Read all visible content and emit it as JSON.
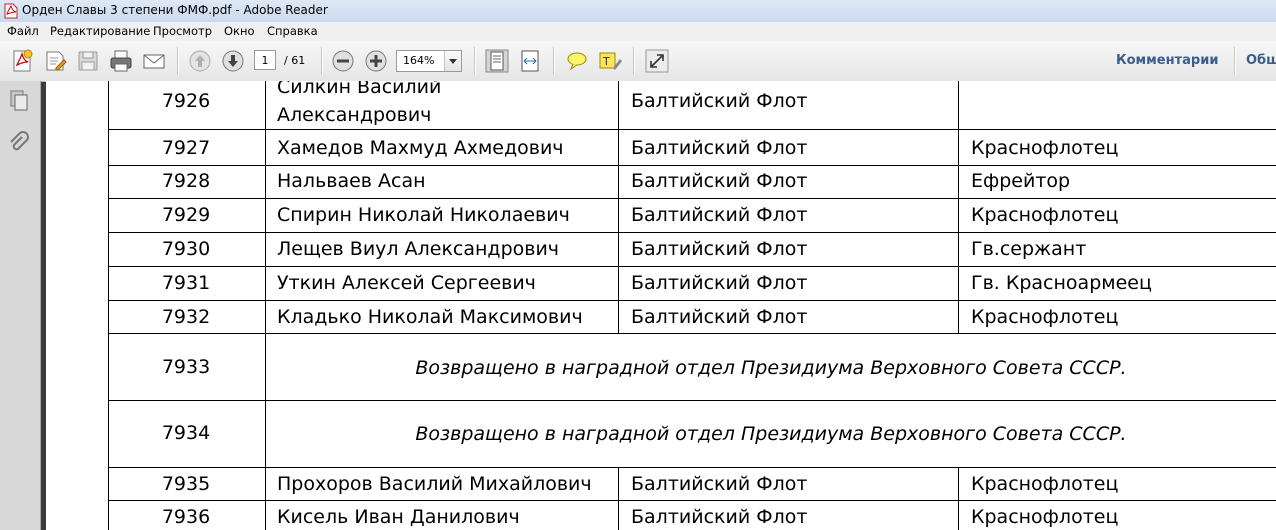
{
  "window": {
    "title": "Орден Славы 3 степени ФМФ.pdf - Adobe Reader"
  },
  "menu": [
    "Файл",
    "Редактирование",
    "Просмотр",
    "Окно",
    "Справка"
  ],
  "toolbar": {
    "current_page": "1",
    "total_pages": "/ 61",
    "zoom": "164%",
    "comments_label": "Комментарии",
    "share_label": "Общ"
  },
  "icons": {
    "create": "create-pdf-icon",
    "edit": "edit-icon",
    "save": "save-icon",
    "print": "print-icon",
    "email": "email-icon",
    "prev": "arrow-up-icon",
    "next": "arrow-down-icon",
    "zoom_out": "zoom-out-icon",
    "zoom_in": "zoom-in-icon",
    "fit_page": "fit-page-icon",
    "fit_width": "fit-width-icon",
    "comment": "comment-icon",
    "highlight": "highlight-icon",
    "fullscreen": "expand-icon"
  },
  "document": {
    "rows": [
      {
        "num": "7926",
        "name_line1": "Силкин Василий",
        "name_line2": "Александрович",
        "fleet": "Балтийский Флот",
        "rank": ""
      },
      {
        "num": "7927",
        "name": "Хамедов Махмуд Ахмедович",
        "fleet": "Балтийский Флот",
        "rank": "Краснофлотец"
      },
      {
        "num": "7928",
        "name": "Нальваев Асан",
        "fleet": "Балтийский Флот",
        "rank": "Ефрейтор"
      },
      {
        "num": "7929",
        "name": "Спирин Николай Николаевич",
        "fleet": "Балтийский Флот",
        "rank": "Краснофлотец"
      },
      {
        "num": "7930",
        "name": "Лещев Виул Александрович",
        "fleet": "Балтийский Флот",
        "rank": "Гв.сержант"
      },
      {
        "num": "7931",
        "name": "Уткин Алексей Сергеевич",
        "fleet": "Балтийский Флот",
        "rank": "Гв. Красноармеец"
      },
      {
        "num": "7932",
        "name": "Кладько Николай Максимович",
        "fleet": "Балтийский Флот",
        "rank": "Краснофлотец"
      },
      {
        "num": "7933",
        "note": "Возвращено в наградной отдел Президиума Верховного Совета СССР."
      },
      {
        "num": "7934",
        "note": "Возвращено в наградной отдел Президиума Верховного Совета СССР."
      },
      {
        "num": "7935",
        "name": "Прохоров Василий Михайлович",
        "fleet": "Балтийский Флот",
        "rank": "Краснофлотец"
      },
      {
        "num": "7936",
        "name": "Кисель Иван Данилович",
        "fleet": "Балтийский Флот",
        "rank": "Краснофлотец"
      }
    ]
  }
}
